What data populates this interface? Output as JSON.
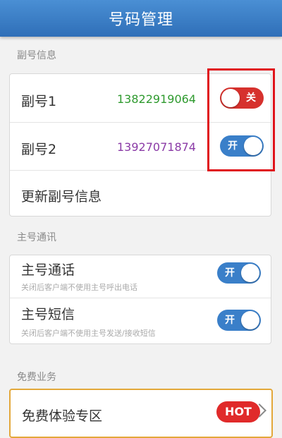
{
  "header": {
    "title": "号码管理"
  },
  "sections": {
    "sub_info": "副号信息",
    "main_comm": "主号通讯",
    "free_service": "免费业务"
  },
  "sub_numbers": [
    {
      "label": "副号1",
      "number": "13822919064",
      "number_color": "#2e9a2e",
      "toggle_text": "关",
      "state": "off"
    },
    {
      "label": "副号2",
      "number": "13927071874",
      "number_color": "#8a3aa6",
      "toggle_text": "开",
      "state": "on"
    }
  ],
  "update_sub_info": "更新副号信息",
  "main_options": [
    {
      "label": "主号通话",
      "desc": "关闭后客户端不使用主号呼出电话",
      "toggle_text": "开",
      "state": "on"
    },
    {
      "label": "主号短信",
      "desc": "关闭后客户端不使用主号发送/接收短信",
      "toggle_text": "开",
      "state": "on"
    }
  ],
  "free_item": {
    "label": "免费体验专区",
    "badge": "HOT"
  },
  "colors": {
    "header": "#3a7fc9",
    "toggle_on": "#3a7fc9",
    "toggle_off": "#d6312d",
    "highlight": "#e0141b",
    "free_border": "#e3a83a"
  }
}
